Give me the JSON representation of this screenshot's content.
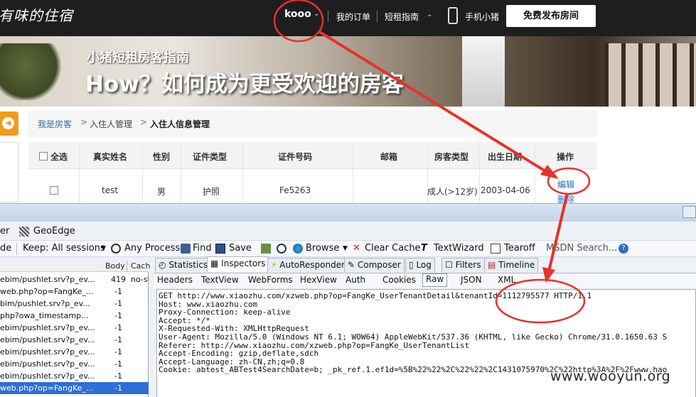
{
  "site": {
    "logo": "有味的住宿",
    "user": "kooo",
    "orders": "我的订单",
    "guide": "短租指南",
    "mobile": "手机小猪",
    "publish": "免费发布房间"
  },
  "banner": {
    "subtitle": "小猪短租房客指南",
    "title": "How？如何成为更受欢迎的房客"
  },
  "breadcrumb": [
    "我是房客",
    "入住人管理",
    "入住人信息管理"
  ],
  "table": {
    "headers": [
      "全选",
      "真实姓名",
      "性别",
      "证件类型",
      "证件号码",
      "邮箱",
      "房客类型",
      "出生日期",
      "操作"
    ],
    "row": {
      "name": "test",
      "gender": "男",
      "idtype": "护照",
      "idnum": "Fe5263",
      "email": "",
      "type": "成人(>12岁)",
      "birth": "2003-04-06"
    },
    "actions": {
      "edit": "编辑",
      "delete": "删除"
    }
  },
  "fiddler": {
    "menu": [
      "er",
      "GeoEdge"
    ],
    "toolbar": [
      "de",
      "Keep: All sessions",
      "Any Process",
      "Find",
      "Save",
      "Browse",
      "Clear Cache",
      "TextWizard",
      "Tearoff",
      "MSDN Search..."
    ],
    "sessions_header": {
      "body": "Body",
      "cache": "Cach"
    },
    "sessions": [
      {
        "url": "ebim/pushlet.srv?p_ev...",
        "body": "419",
        "extra": "no-st"
      },
      {
        "url": "web.php?op=FangKe_...",
        "body": "-1",
        "extra": ""
      },
      {
        "url": "bim/pushlet.srv?p_ev...",
        "body": "-1",
        "extra": ""
      },
      {
        "url": "php?owa_timestamp...",
        "body": "-1",
        "extra": ""
      },
      {
        "url": "ebim/pushlet.srv?p_ev...",
        "body": "-1",
        "extra": ""
      },
      {
        "url": "ebim/pushlet.srv?p_ev...",
        "body": "-1",
        "extra": ""
      },
      {
        "url": "ebim/pushlet.srv?p_ev...",
        "body": "-1",
        "extra": ""
      },
      {
        "url": "ebim/pushlet.srv?p_ev...",
        "body": "-1",
        "extra": ""
      },
      {
        "url": "ebim/pushlet.srv?p_ev...",
        "body": "-1",
        "extra": ""
      },
      {
        "url": "web.php?op=FangKe_...",
        "body": "-1",
        "extra": ""
      }
    ],
    "tabs1": [
      "Statistics",
      "Inspectors",
      "AutoResponder",
      "Composer",
      "Log",
      "Filters",
      "Timeline"
    ],
    "tabs2": [
      "Headers",
      "TextView",
      "WebForms",
      "HexView",
      "Auth",
      "Cookies",
      "Raw",
      "JSON",
      "XML"
    ],
    "raw_lines": [
      "GET http://www.xiaozhu.com/xzweb.php?op=FangKe_UserTenantDetail&tenantId=1112795577 HTTP/1.1",
      "Host: www.xiaozhu.com",
      "Proxy-Connection: keep-alive",
      "Accept: */*",
      "X-Requested-With: XMLHttpRequest",
      "User-Agent: Mozilla/5.0 (Windows NT 6.1; WOW64) AppleWebKit/537.36 (KHTML, like Gecko) Chrome/31.0.1650.63 S",
      "Referer: http://www.xiaozhu.com/xzweb.php?op=FangKe_UserTenantList",
      "Accept-Encoding: gzip,deflate,sdch",
      "Accept-Language: zh-CN,zh;q=0.8",
      "Cookie: abtest_ABTest4SearchDate=b; _pk_ref.1.ef1d=%5B%22%22%2C%22%22%2C1431075970%2C%22http%3A%2F%2Fwww.hao"
    ]
  },
  "watermark": "www.wooyun.org",
  "colors": {
    "accent": "#f39b1b",
    "annotation": "#e8312a",
    "link": "#2a6ac2",
    "selection": "#2c6fd6"
  }
}
